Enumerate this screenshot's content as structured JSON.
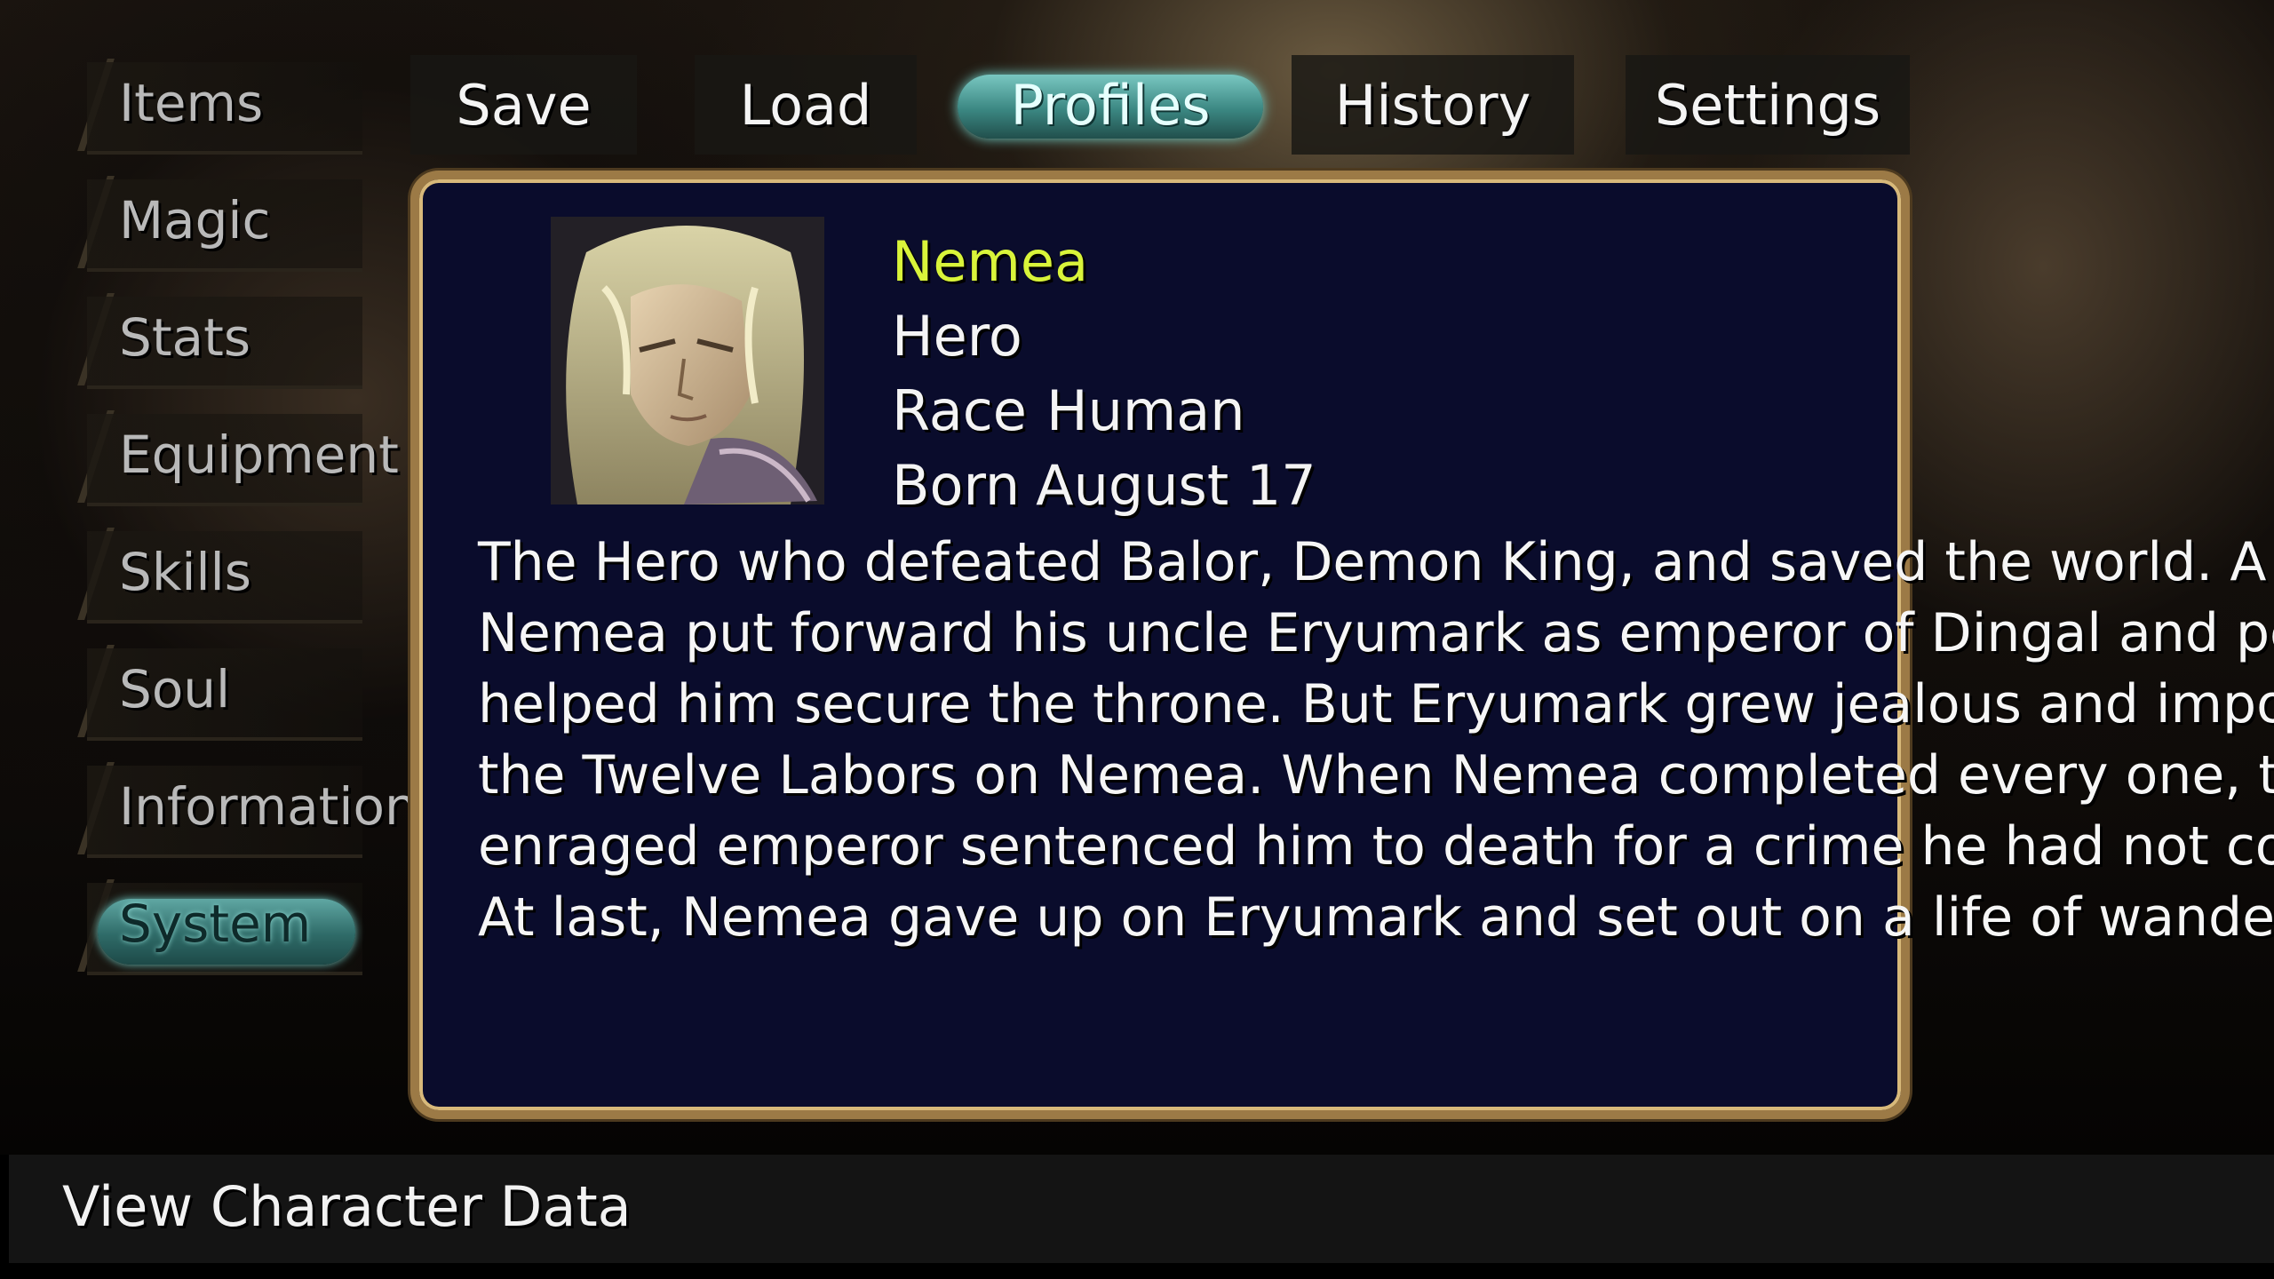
{
  "sidebar": {
    "items": [
      {
        "label": "Items",
        "active": false
      },
      {
        "label": "Magic",
        "active": false
      },
      {
        "label": "Stats",
        "active": false
      },
      {
        "label": "Equipment",
        "active": false
      },
      {
        "label": "Skills",
        "active": false
      },
      {
        "label": "Soul",
        "active": false
      },
      {
        "label": "Information",
        "active": false
      },
      {
        "label": "System",
        "active": true
      }
    ]
  },
  "tabs": [
    {
      "label": "Save",
      "active": false
    },
    {
      "label": "Load",
      "active": false
    },
    {
      "label": "Profiles",
      "active": true
    },
    {
      "label": "History",
      "active": false
    },
    {
      "label": "Settings",
      "active": false
    }
  ],
  "profile": {
    "name": "Nemea",
    "title": "Hero",
    "race_label": "Race",
    "race": "Human",
    "born_label": "Born",
    "born": "August 17",
    "description_lines": [
      "The Hero who defeated Balor, Demon King, and saved the world. A",
      "Nemea put forward his uncle Eryumark as emperor of Dingal and pe",
      "helped him secure the throne. But Eryumark grew jealous and impo",
      "the Twelve Labors on Nemea. When Nemea completed every one, t",
      "enraged emperor sentenced him to death for a crime he had not co",
      "At last, Nemea gave up on Eryumark and set out on a life of wande"
    ]
  },
  "footer": {
    "help_text": "View Character Data"
  },
  "colors": {
    "name_highlight": "#d9f43a",
    "panel_bg": "#0a0c2c",
    "panel_border": "#9c7a46",
    "active_pill": "#3b8782"
  }
}
